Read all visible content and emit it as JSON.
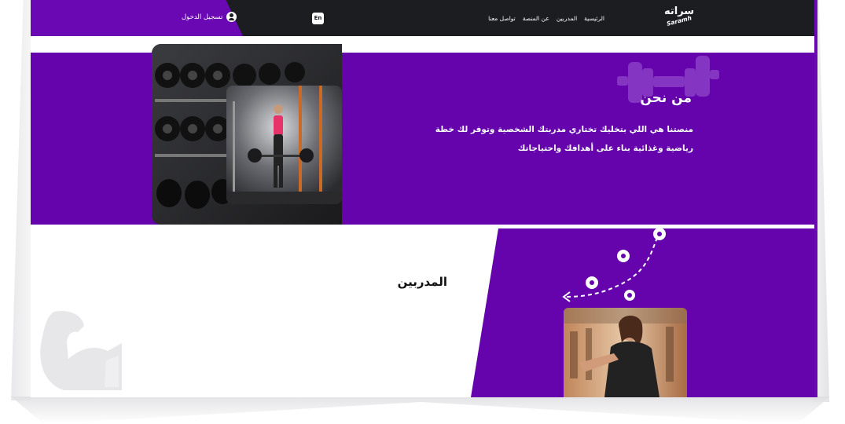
{
  "navbar": {
    "logo_ar": "سراته",
    "logo_en": "Saramh",
    "links": [
      "الرئيسية",
      "المدربين",
      "عن المنصة",
      "تواصل معنا"
    ],
    "lang_label": "En",
    "login_label": "تسجيل الدخول"
  },
  "about": {
    "title": "من نحن",
    "text": "منصتنا هي اللي بتخليك تختاري مدربتك الشخصية وتوفر لك خطة رياضية وغذائية بناء على أهدافك واحتياجاتك"
  },
  "trainers": {
    "title": "المدربين"
  },
  "colors": {
    "primary_purple": "#6504ad",
    "navbar_dark": "#1c1d21",
    "white": "#ffffff"
  },
  "icons": [
    "user-icon",
    "dumbbell-icon",
    "muscle-arm-icon",
    "route-icon"
  ]
}
